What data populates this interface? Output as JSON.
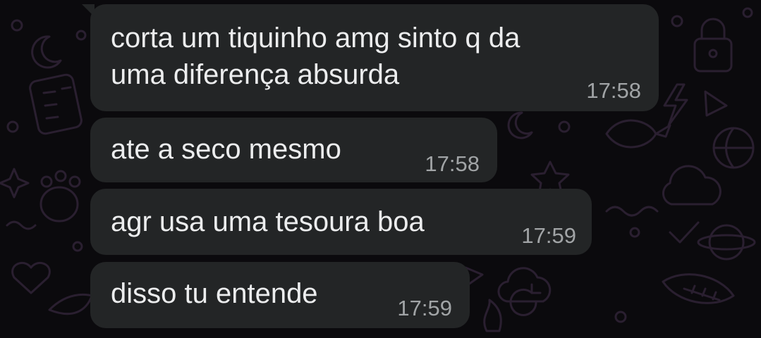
{
  "wallpaper": {
    "icon_names": [
      "crescent-moon-icon",
      "padlock-icon",
      "calculator-icon",
      "paw-icon",
      "bird-icon",
      "globe-icon",
      "heart-icon",
      "star-icon",
      "lightning-icon",
      "leaf-icon",
      "cloud-icon",
      "sparkle-icon"
    ]
  },
  "colors": {
    "background": "#0b0a0d",
    "wallpaper_doodle": "#2a1f30",
    "bubble": "#232526",
    "message_text": "#ecedee",
    "timestamp": "#a1a4a6"
  },
  "messages": [
    {
      "text_line1": "corta um tiquinho amg sinto q da",
      "text_line2": "uma diferença absurda",
      "time": "17:58"
    },
    {
      "text": "ate a seco mesmo",
      "time": "17:58"
    },
    {
      "text": "agr usa uma tesoura boa",
      "time": "17:59"
    },
    {
      "text": "disso tu entende",
      "time": "17:59"
    }
  ]
}
